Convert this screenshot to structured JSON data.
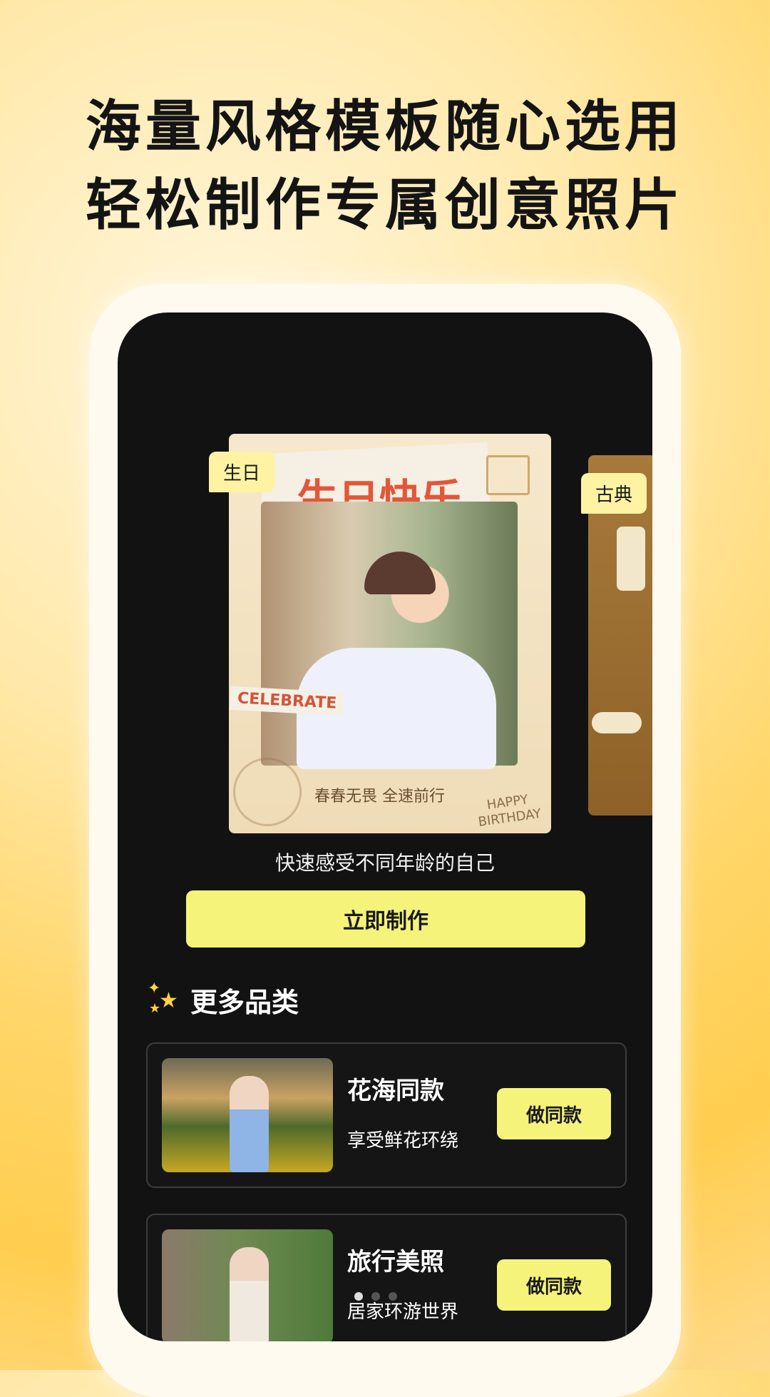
{
  "headline": {
    "line1": "海量风格模板随心选用",
    "line2": "轻松制作专属创意照片"
  },
  "carousel": {
    "main": {
      "tag": "生日",
      "title": "生日快乐",
      "celebrate": "CELEBRATE",
      "slogan": "春春无畏 全速前行",
      "happy": "HAPPY",
      "birthday": "BIRTHDAY"
    },
    "side": {
      "tag": "古典"
    }
  },
  "description": "快速感受不同年龄的自己",
  "cta_label": "立即制作",
  "section_title": "更多品类",
  "items": [
    {
      "title": "花海同款",
      "subtitle": "享受鲜花环绕",
      "button": "做同款"
    },
    {
      "title": "旅行美照",
      "subtitle": "居家环游世界",
      "button": "做同款"
    }
  ],
  "colors": {
    "accent": "#f5f37a",
    "screen": "#121212",
    "tag": "#fdf3a3"
  },
  "icons": [
    "stars-icon",
    "gift-icon",
    "stamp-icon"
  ]
}
